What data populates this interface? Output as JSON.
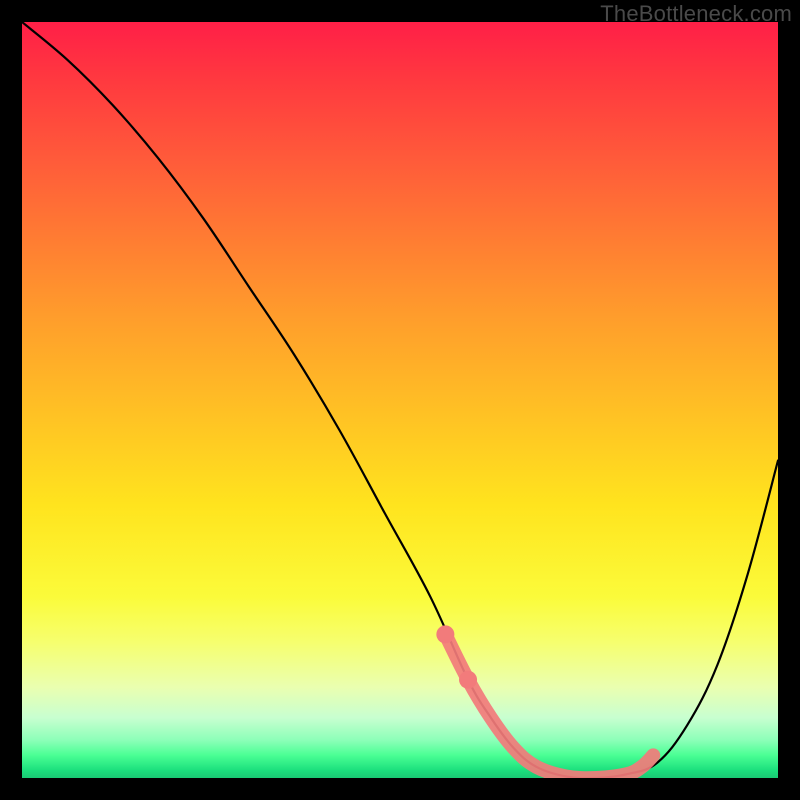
{
  "attribution": "TheBottleneck.com",
  "colors": {
    "background": "#000000",
    "curve": "#000000",
    "highlight": "#f27b7b"
  },
  "chart_data": {
    "type": "line",
    "title": "",
    "xlabel": "",
    "ylabel": "",
    "xlim": [
      0,
      100
    ],
    "ylim": [
      0,
      100
    ],
    "grid": false,
    "legend": false,
    "series": [
      {
        "name": "bottleneck-curve",
        "x": [
          0,
          6,
          12,
          18,
          24,
          30,
          36,
          42,
          48,
          54,
          59,
          62,
          65,
          68,
          72,
          76,
          80,
          84,
          88,
          92,
          96,
          100
        ],
        "y": [
          100,
          95,
          89,
          82,
          74,
          65,
          56,
          46,
          35,
          24,
          13,
          8,
          4,
          1.5,
          0.2,
          0,
          0.5,
          2,
          7,
          15,
          27,
          42
        ]
      }
    ],
    "annotations": [
      {
        "name": "highlight-segment",
        "description": "salmon-highlighted near-bottom portion of curve",
        "x": [
          56,
          59,
          62,
          65,
          68,
          72,
          76,
          80,
          82,
          83.5
        ],
        "y": [
          19,
          13,
          8,
          4,
          1.5,
          0.2,
          0,
          0.5,
          1.5,
          3
        ]
      }
    ]
  }
}
